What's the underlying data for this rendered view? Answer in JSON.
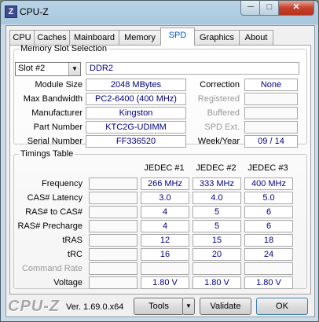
{
  "window": {
    "title": "CPU-Z",
    "icon_letter": "Z"
  },
  "controls": {
    "minimize": "─",
    "maximize": "□",
    "close": "✕"
  },
  "tabs": [
    {
      "label": "CPU"
    },
    {
      "label": "Caches"
    },
    {
      "label": "Mainboard"
    },
    {
      "label": "Memory"
    },
    {
      "label": "SPD",
      "active": true
    },
    {
      "label": "Graphics"
    },
    {
      "label": "About"
    }
  ],
  "slot": {
    "legend": "Memory Slot Selection",
    "selected": "Slot #2",
    "type": "DDR2",
    "labels": {
      "module_size": "Module Size",
      "max_bandwidth": "Max Bandwidth",
      "manufacturer": "Manufacturer",
      "part_number": "Part Number",
      "serial_number": "Serial Number",
      "correction": "Correction",
      "registered": "Registered",
      "buffered": "Buffered",
      "spd_ext": "SPD Ext.",
      "week_year": "Week/Year"
    },
    "values": {
      "module_size": "2048 MBytes",
      "max_bandwidth": "PC2-6400 (400 MHz)",
      "manufacturer": "Kingston",
      "part_number": "KTC2G-UDIMM",
      "serial_number": "FF336520",
      "correction": "None",
      "registered": "",
      "buffered": "",
      "spd_ext": "",
      "week_year": "09 / 14"
    }
  },
  "timings": {
    "legend": "Timings Table",
    "columns": [
      "JEDEC #1",
      "JEDEC #2",
      "JEDEC #3"
    ],
    "rows": [
      {
        "label": "Frequency",
        "values": [
          "266 MHz",
          "333 MHz",
          "400 MHz"
        ]
      },
      {
        "label": "CAS# Latency",
        "values": [
          "3.0",
          "4.0",
          "5.0"
        ]
      },
      {
        "label": "RAS# to CAS#",
        "values": [
          "4",
          "5",
          "6"
        ]
      },
      {
        "label": "RAS# Precharge",
        "values": [
          "4",
          "5",
          "6"
        ]
      },
      {
        "label": "tRAS",
        "values": [
          "12",
          "15",
          "18"
        ]
      },
      {
        "label": "tRC",
        "values": [
          "16",
          "20",
          "24"
        ]
      },
      {
        "label": "Command Rate",
        "values": [
          "",
          "",
          ""
        ],
        "dim": true
      },
      {
        "label": "Voltage",
        "values": [
          "1.80 V",
          "1.80 V",
          "1.80 V"
        ]
      }
    ]
  },
  "footer": {
    "brand": "CPU-Z",
    "version": "Ver. 1.69.0.x64",
    "tools": "Tools",
    "tools_arrow": "▼",
    "validate": "Validate",
    "ok": "OK"
  }
}
